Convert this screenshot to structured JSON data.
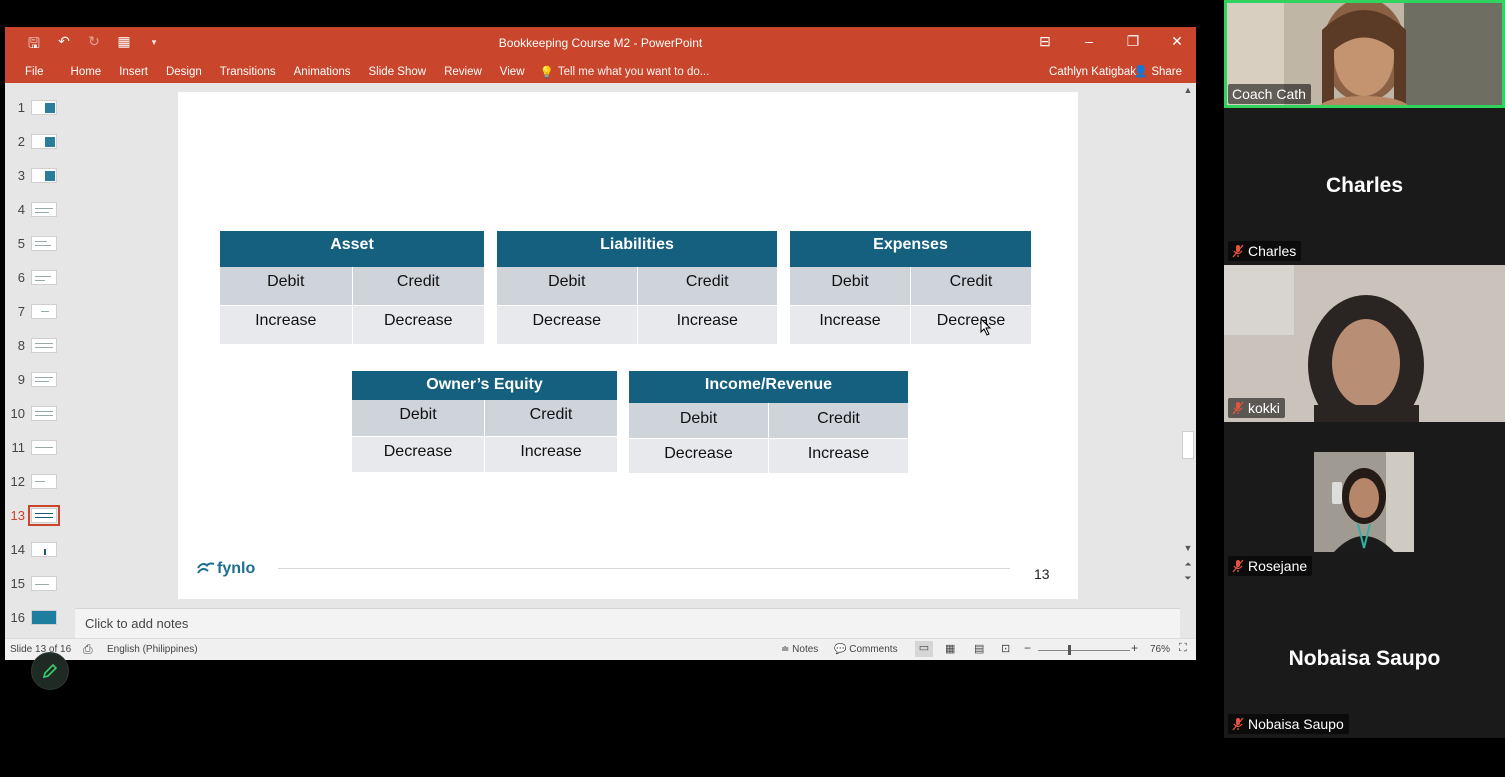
{
  "app": {
    "doc_title": "Bookkeeping Course M2 - PowerPoint",
    "ribbon_tabs": [
      "File",
      "Home",
      "Insert",
      "Design",
      "Transitions",
      "Animations",
      "Slide Show",
      "Review",
      "View"
    ],
    "tell_me": "Tell me what you want to do...",
    "user_name": "Cathlyn Katigbak",
    "share_label": "Share"
  },
  "thumbnails": [
    "1",
    "2",
    "3",
    "4",
    "5",
    "6",
    "7",
    "8",
    "9",
    "10",
    "11",
    "12",
    "13",
    "14",
    "15",
    "16"
  ],
  "active_slide": "13",
  "slide": {
    "tables": [
      {
        "title": "Asset",
        "debit": "Debit",
        "credit": "Credit",
        "debit_effect": "Increase",
        "credit_effect": "Decrease"
      },
      {
        "title": "Liabilities",
        "debit": "Debit",
        "credit": "Credit",
        "debit_effect": "Decrease",
        "credit_effect": "Increase"
      },
      {
        "title": "Expenses",
        "debit": "Debit",
        "credit": "Credit",
        "debit_effect": "Increase",
        "credit_effect": "Decrease"
      },
      {
        "title": "Owner’s Equity",
        "debit": "Debit",
        "credit": "Credit",
        "debit_effect": "Decrease",
        "credit_effect": "Increase"
      },
      {
        "title": "Income/Revenue",
        "debit": "Debit",
        "credit": "Credit",
        "debit_effect": "Decrease",
        "credit_effect": "Increase"
      }
    ],
    "logo": "fynlo",
    "page_number": "13"
  },
  "notes_placeholder": "Click to add notes",
  "status": {
    "slide_info": "Slide 13 of 16",
    "language": "English (Philippines)",
    "notes": "Notes",
    "comments": "Comments",
    "zoom": "76%"
  },
  "participants": [
    {
      "name": "Coach Cath",
      "has_video": true
    },
    {
      "name": "Charles",
      "has_video": false,
      "muted": true
    },
    {
      "name": "kokki",
      "has_video": true,
      "muted": true
    },
    {
      "name": "Rosejane",
      "has_video": true,
      "muted": true
    },
    {
      "name": "Nobaisa Saupo",
      "has_video": false,
      "muted": true
    }
  ],
  "colors": {
    "ppt_accent": "#c9452b",
    "table_header": "#15607f",
    "active_speaker": "#2fd35e"
  }
}
